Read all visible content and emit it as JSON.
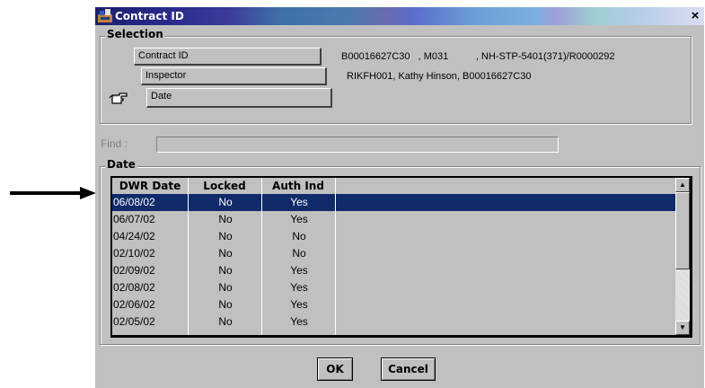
{
  "window": {
    "title": "Contract ID",
    "close_label": "×"
  },
  "selection": {
    "legend": "Selection",
    "contract": {
      "label": "Contract ID",
      "value": "B00016627C30   , M031          , NH-STP-5401(371)/R0000292"
    },
    "inspector": {
      "label": "Inspector",
      "value": "RIKFH001, Kathy Hinson, B00016627C30"
    },
    "date": {
      "label": "Date"
    }
  },
  "find": {
    "label": "Find :",
    "value": ""
  },
  "date_group": {
    "legend": "Date",
    "columns": [
      "DWR Date",
      "Locked",
      "Auth Ind"
    ],
    "rows": [
      {
        "date": "06/08/02",
        "locked": "No",
        "auth": "Yes"
      },
      {
        "date": "06/07/02",
        "locked": "No",
        "auth": "Yes"
      },
      {
        "date": "04/24/02",
        "locked": "No",
        "auth": "No"
      },
      {
        "date": "02/10/02",
        "locked": "No",
        "auth": "No"
      },
      {
        "date": "02/09/02",
        "locked": "No",
        "auth": "Yes"
      },
      {
        "date": "02/08/02",
        "locked": "No",
        "auth": "Yes"
      },
      {
        "date": "02/06/02",
        "locked": "No",
        "auth": "Yes"
      },
      {
        "date": "02/05/02",
        "locked": "No",
        "auth": "Yes"
      }
    ],
    "selected_row": 0
  },
  "buttons": {
    "ok": "OK",
    "cancel": "Cancel"
  },
  "colors": {
    "selection": "#102a6a",
    "dialog_bg": "#c0c0c0"
  }
}
